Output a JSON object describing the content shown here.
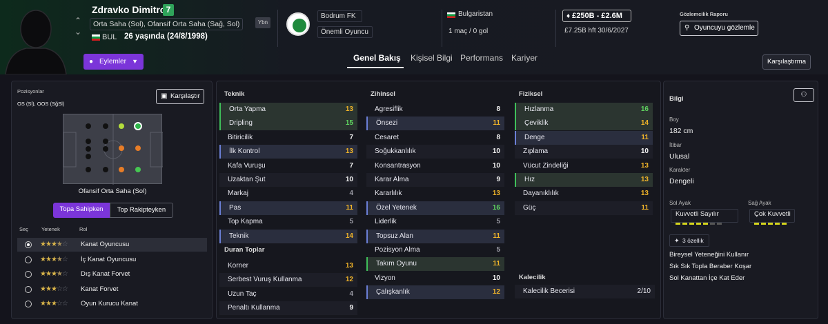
{
  "player": {
    "name": "Zdravko Dimitrov",
    "number": "7",
    "positions": "Orta Saha (Sol), Ofansif Orta Saha (Sağ, Sol)",
    "nationality": "BUL",
    "age": "26 yaşında (24/8/1998)",
    "badge": "Ybn"
  },
  "club": {
    "name": "Bodrum FK",
    "role": "Önemli Oyuncu"
  },
  "international": {
    "country": "Bulgaristan",
    "stats": "1 maç / 0 gol"
  },
  "contract": {
    "value_range": "£250B - £2.6M",
    "wage": "£7.25B hft",
    "expiry": "30/6/2027"
  },
  "scouting": {
    "title": "Gözlemcilik Raporu",
    "button": "Oyuncuyu gözlemle"
  },
  "actions_label": "Eylemler",
  "tabs": [
    "Genel Bakış",
    "Kişisel Bilgi",
    "Performans",
    "Kariyer"
  ],
  "compare_top": "Karşılaştırma",
  "positions_panel": {
    "title": "Pozisyonlar",
    "positions_short": "OS (Sl), OOS (SğSl)",
    "compare_btn": "Karşılaştır",
    "selected_position": "Ofansif Orta Saha (Sol)",
    "toggle": [
      "Topa Sahipken",
      "Top Rakipteyken"
    ],
    "col_headers": [
      "Seç",
      "Yetenek",
      "Rol"
    ],
    "roles": [
      {
        "name": "Kanat Oyuncusu",
        "stars": 3.5,
        "selected": true
      },
      {
        "name": "İç Kanat Oyuncusu",
        "stars": 3.5,
        "selected": false
      },
      {
        "name": "Dış Kanat Forvet",
        "stars": 3.5,
        "selected": false
      },
      {
        "name": "Kanat Forvet",
        "stars": 3,
        "selected": false
      },
      {
        "name": "Oyun Kurucu Kanat",
        "stars": 3,
        "selected": false
      }
    ]
  },
  "technical": {
    "title": "Teknik",
    "items": [
      {
        "name": "Orta Yapma",
        "value": "13",
        "hl": "green"
      },
      {
        "name": "Dripling",
        "value": "15",
        "hl": "green"
      },
      {
        "name": "Bitiricilik",
        "value": "7",
        "hl": ""
      },
      {
        "name": "İlk Kontrol",
        "value": "13",
        "hl": "blue"
      },
      {
        "name": "Kafa Vuruşu",
        "value": "7",
        "hl": ""
      },
      {
        "name": "Uzaktan Şut",
        "value": "10",
        "hl": ""
      },
      {
        "name": "Markaj",
        "value": "4",
        "hl": ""
      },
      {
        "name": "Pas",
        "value": "11",
        "hl": "blue"
      },
      {
        "name": "Top Kapma",
        "value": "5",
        "hl": ""
      },
      {
        "name": "Teknik",
        "value": "14",
        "hl": "blue"
      }
    ]
  },
  "set_pieces": {
    "title": "Duran Toplar",
    "items": [
      {
        "name": "Korner",
        "value": "13",
        "hl": ""
      },
      {
        "name": "Serbest Vuruş Kullanma",
        "value": "12",
        "hl": ""
      },
      {
        "name": "Uzun Taç",
        "value": "4",
        "hl": ""
      },
      {
        "name": "Penaltı Kullanma",
        "value": "9",
        "hl": ""
      }
    ]
  },
  "mental": {
    "title": "Zihinsel",
    "items": [
      {
        "name": "Agresiflik",
        "value": "8",
        "hl": ""
      },
      {
        "name": "Önsezi",
        "value": "11",
        "hl": "blue"
      },
      {
        "name": "Cesaret",
        "value": "8",
        "hl": ""
      },
      {
        "name": "Soğukkanlılık",
        "value": "10",
        "hl": ""
      },
      {
        "name": "Konsantrasyon",
        "value": "10",
        "hl": ""
      },
      {
        "name": "Karar Alma",
        "value": "9",
        "hl": ""
      },
      {
        "name": "Kararlılık",
        "value": "13",
        "hl": ""
      },
      {
        "name": "Özel Yetenek",
        "value": "16",
        "hl": "blue"
      },
      {
        "name": "Liderlik",
        "value": "5",
        "hl": ""
      },
      {
        "name": "Topsuz Alan",
        "value": "11",
        "hl": "blue"
      },
      {
        "name": "Pozisyon Alma",
        "value": "5",
        "hl": ""
      },
      {
        "name": "Takım Oyunu",
        "value": "11",
        "hl": "green"
      },
      {
        "name": "Vizyon",
        "value": "10",
        "hl": ""
      },
      {
        "name": "Çalışkanlık",
        "value": "12",
        "hl": "blue"
      }
    ]
  },
  "physical": {
    "title": "Fiziksel",
    "items": [
      {
        "name": "Hızlanma",
        "value": "16",
        "hl": "green"
      },
      {
        "name": "Çeviklik",
        "value": "14",
        "hl": "green"
      },
      {
        "name": "Denge",
        "value": "11",
        "hl": "blue"
      },
      {
        "name": "Zıplama",
        "value": "10",
        "hl": ""
      },
      {
        "name": "Vücut Zindeliği",
        "value": "13",
        "hl": ""
      },
      {
        "name": "Hız",
        "value": "13",
        "hl": "green"
      },
      {
        "name": "Dayanıklılık",
        "value": "13",
        "hl": ""
      },
      {
        "name": "Güç",
        "value": "11",
        "hl": ""
      }
    ]
  },
  "goalkeeping": {
    "title": "Kalecilik",
    "name": "Kalecilik Becerisi",
    "value": "2/10"
  },
  "info": {
    "title": "Bilgi",
    "height_label": "Boy",
    "height": "182 cm",
    "rep_label": "İtibar",
    "rep": "Ulusal",
    "char_label": "Karakter",
    "char": "Dengeli",
    "left_foot_label": "Sol Ayak",
    "left_foot": "Kuvvetli Sayılır",
    "right_foot_label": "Sağ Ayak",
    "right_foot": "Çok Kuvvetli",
    "traits_btn": "3 özellik",
    "traits": [
      "Bireysel Yeteneğini Kullanır",
      "Sık Sık Topla Beraber Koşar",
      "Sol Kanattan İçe Kat Eder"
    ]
  }
}
